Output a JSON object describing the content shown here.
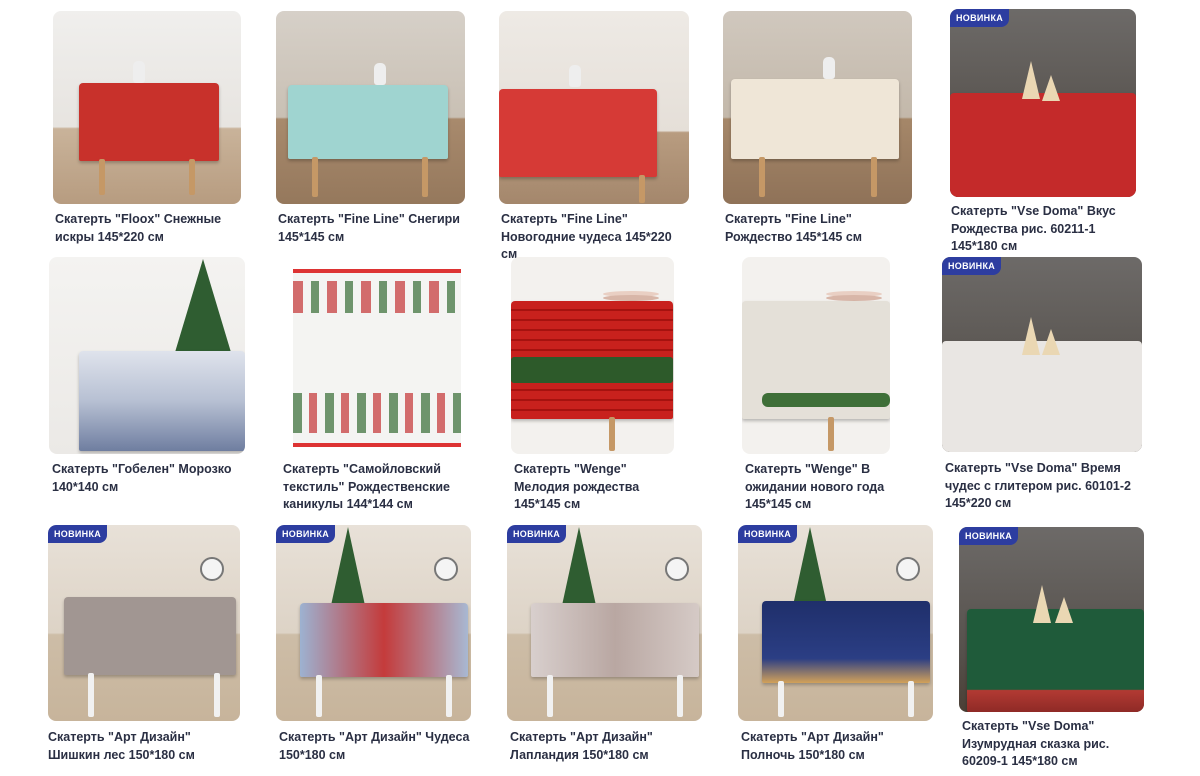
{
  "badge_label": "НОВИНКА",
  "products": [
    {
      "title": "Скатерть \"Floox\" Снежные искры 145*220 см"
    },
    {
      "title": "Скатерть \"Fine Line\" Снегири 145*145 см"
    },
    {
      "title": "Скатерть \"Fine Line\" Новогодние чудеса 145*220 см"
    },
    {
      "title": "Скатерть \"Fine Line\" Рождество 145*145 см"
    },
    {
      "title": "Скатерть \"Vse Doma\" Вкус Рождества рис. 60211-1 145*180 см"
    },
    {
      "title": "Скатерть \"Гобелен\" Морозко 140*140 см"
    },
    {
      "title": "Скатерть \"Самойловский текстиль\" Рождественские каникулы 144*144 см"
    },
    {
      "title": "Скатерть \"Wenge\" Мелодия рождества 145*145 см"
    },
    {
      "title": "Скатерть \"Wenge\" В ожидании нового года 145*145 см"
    },
    {
      "title": "Скатерть \"Vse Doma\" Время чудес с глитером рис. 60101-2 145*220 см"
    },
    {
      "title": "Скатерть \"Арт Дизайн\" Шишкин лес 150*180 см"
    },
    {
      "title": "Скатерть \"Арт Дизайн\" Чудеса 150*180 см"
    },
    {
      "title": "Скатерть \"Арт Дизайн\" Лапландия 150*180 см"
    },
    {
      "title": "Скатерть \"Арт Дизайн\" Полночь 150*180 см"
    },
    {
      "title": "Скатерть \"Vse Doma\" Изумрудная сказка рис. 60209-1 145*180 см"
    }
  ],
  "colors": {
    "badge": "#2d3da0",
    "title_text": "#2a2f43"
  }
}
